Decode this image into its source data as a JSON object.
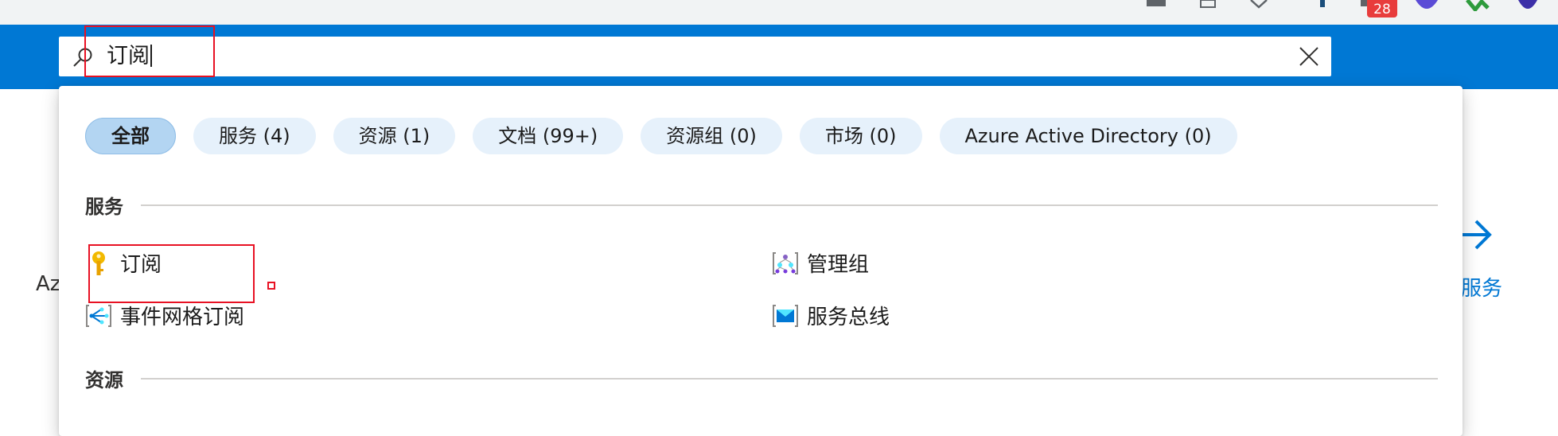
{
  "browser": {
    "extension_badge_count": "28"
  },
  "search": {
    "value": "订阅",
    "placeholder": "",
    "clear_icon": "close-icon",
    "search_icon": "search-icon"
  },
  "background": {
    "left_text": "Az",
    "right_link": "服务"
  },
  "filters": [
    {
      "label": "全部",
      "active": true
    },
    {
      "label": "服务  (4)",
      "active": false
    },
    {
      "label": "资源  (1)",
      "active": false
    },
    {
      "label": "文档  (99+)",
      "active": false
    },
    {
      "label": "资源组  (0)",
      "active": false
    },
    {
      "label": "市场  (0)",
      "active": false
    },
    {
      "label": "Azure Active Directory  (0)",
      "active": false
    }
  ],
  "sections": {
    "services_title": "服务",
    "resources_title": "资源"
  },
  "services": [
    {
      "label": "订阅",
      "icon": "key-icon"
    },
    {
      "label": "管理组",
      "icon": "management-group-icon"
    },
    {
      "label": "事件网格订阅",
      "icon": "event-grid-icon"
    },
    {
      "label": "服务总线",
      "icon": "service-bus-icon"
    }
  ],
  "colors": {
    "azure_blue": "#0078d4",
    "pill_bg": "#e6f1fb",
    "pill_active_bg": "#b3d5f2",
    "highlight_red": "#e81123"
  }
}
